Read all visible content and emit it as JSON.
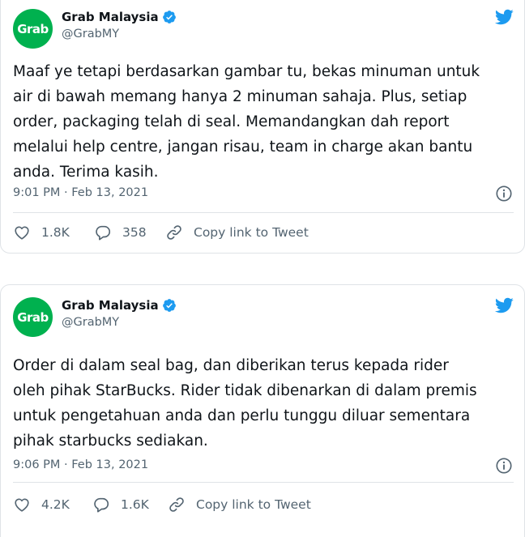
{
  "tweets": [
    {
      "author": {
        "name": "Grab Malaysia",
        "handle": "@GrabMY",
        "avatar_text": "Grab"
      },
      "lines": [
        "Maaf ye tetapi berdasarkan gambar tu, bekas minuman untuk",
        "air di bawah memang hanya 2 minuman sahaja. Plus, setiap",
        "order, packaging telah di seal. Memandangkan dah report",
        "melalui help centre, jangan risau, team in charge akan bantu",
        "anda. Terima kasih."
      ],
      "timestamp": "9:01 PM · Feb 13, 2021",
      "likes": "1.8K",
      "replies": "358",
      "copy_link_label": "Copy link to Tweet"
    },
    {
      "author": {
        "name": "Grab Malaysia",
        "handle": "@GrabMY",
        "avatar_text": "Grab"
      },
      "lines": [
        "Order di dalam seal bag, dan diberikan terus kepada rider",
        "oleh pihak StarBucks. Rider tidak dibenarkan di dalam premis",
        "untuk pengetahuan anda dan perlu tunggu diluar sementara",
        "pihak starbucks sediakan."
      ],
      "timestamp": "9:06 PM · Feb 13, 2021",
      "likes": "4.2K",
      "replies": "1.6K",
      "copy_link_label": "Copy link to Tweet"
    }
  ],
  "icons": {
    "brand": "twitter-bird-icon",
    "verified": "verified-badge-icon",
    "info": "info-icon",
    "like": "heart-icon",
    "reply": "reply-bubble-icon",
    "link": "link-icon"
  },
  "colors": {
    "twitter_blue": "#1d9bf0",
    "grab_green": "#00b14f",
    "secondary_text": "#536471",
    "border": "#dfe3e7"
  }
}
